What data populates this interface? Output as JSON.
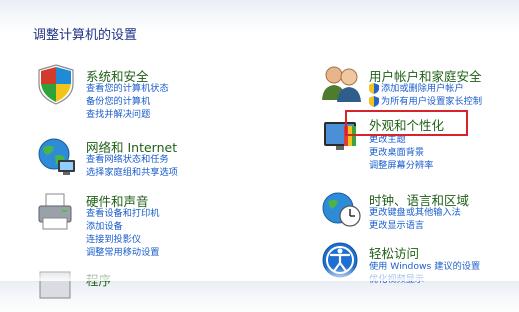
{
  "page": {
    "title": "调整计算机的设置"
  },
  "left": [
    {
      "title": "系统和安全",
      "links": [
        "查看您的计算机状态",
        "备份您的计算机",
        "查找并解决问题"
      ]
    },
    {
      "title": "网络和 Internet",
      "links": [
        "查看网络状态和任务",
        "选择家庭组和共享选项"
      ]
    },
    {
      "title": "硬件和声音",
      "links": [
        "查看设备和打印机",
        "添加设备",
        "连接到投影仪",
        "调整常用移动设置"
      ]
    },
    {
      "title": "程序"
    }
  ],
  "right": [
    {
      "title": "用户帐户和家庭安全",
      "links": [
        "添加或删除用户帐户",
        "为所有用户设置家长控制"
      ]
    },
    {
      "title": "外观和个性化",
      "links": [
        "更改主题",
        "更改桌面背景",
        "调整屏幕分辨率"
      ]
    },
    {
      "title": "时钟、语言和区域",
      "links": [
        "更改键盘或其他输入法",
        "更改显示语言"
      ]
    },
    {
      "title": "轻松访问",
      "links": [
        "使用 Windows 建议的设置",
        "优化视频显示"
      ]
    }
  ]
}
